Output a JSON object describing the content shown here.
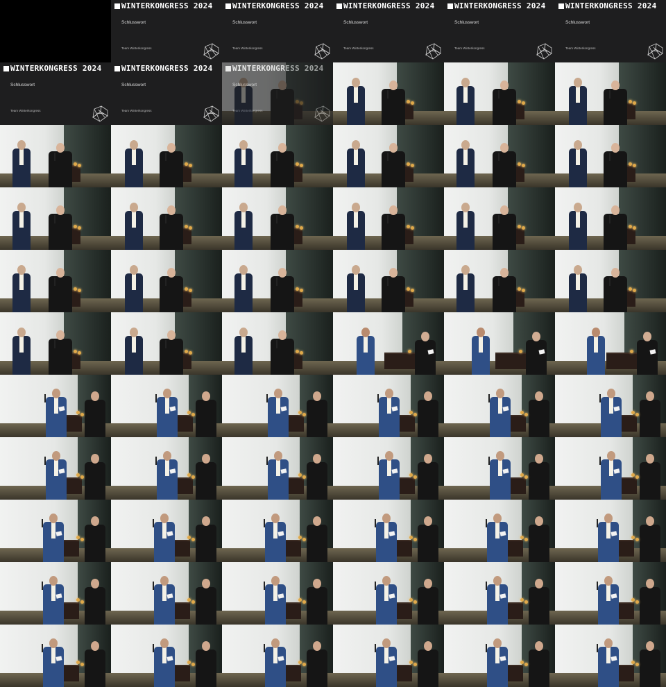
{
  "grid": {
    "columns": 6,
    "rows": 11
  },
  "title_card": {
    "heading": "WINTERKONGRESS 2024",
    "subtitle": "Schlusswort",
    "team": "Team Winterkongress"
  },
  "colors": {
    "title_bg": "#1e1e1f",
    "screen": "#eef0ee",
    "podium": "#2a1d18",
    "suit": "#1e2a44",
    "suit_blue": "#2f4f86",
    "black_top": "#151515"
  },
  "frames": [
    "blank",
    "title",
    "title",
    "title",
    "title",
    "title",
    "title",
    "title",
    "title-fade",
    "stage-a",
    "stage-a",
    "stage-a",
    "stage-a",
    "stage-a",
    "stage-a",
    "stage-a",
    "stage-a",
    "stage-a",
    "stage-a",
    "stage-a",
    "stage-a",
    "stage-a",
    "stage-a",
    "stage-a",
    "stage-a",
    "stage-a",
    "stage-a",
    "stage-a",
    "stage-a",
    "stage-a",
    "stage-a",
    "stage-a",
    "stage-a",
    "stage-b",
    "stage-b",
    "stage-b",
    "stage-c",
    "stage-c",
    "stage-c",
    "stage-c",
    "stage-c",
    "stage-c",
    "stage-c",
    "stage-c",
    "stage-c",
    "stage-c",
    "stage-c",
    "stage-c",
    "stage-c",
    "stage-c",
    "stage-c",
    "stage-c",
    "stage-c",
    "stage-c",
    "stage-c",
    "stage-c",
    "stage-c",
    "stage-c",
    "stage-c",
    "stage-c",
    "stage-c",
    "stage-c",
    "stage-c",
    "stage-c",
    "stage-c",
    "stage-c"
  ]
}
